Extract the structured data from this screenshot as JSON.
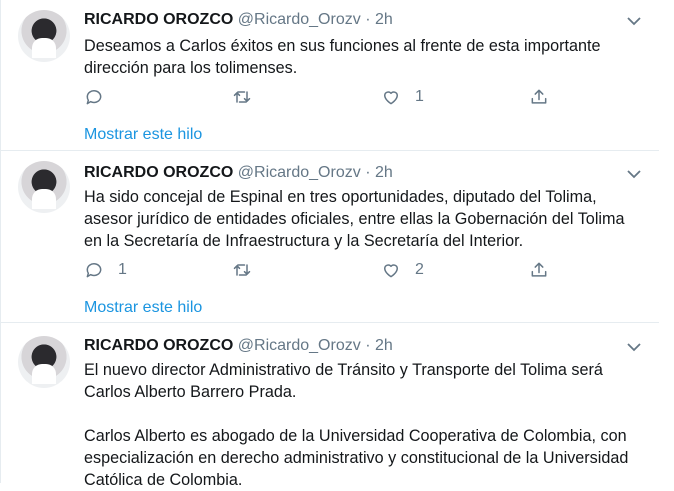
{
  "tweets": [
    {
      "name": "RICARDO OROZCO",
      "handle": "@Ricardo_Orozv",
      "dot": "·",
      "time": "2h",
      "text": "Deseamos a Carlos éxitos en sus funciones al frente de esta importante\ndirección para los tolimenses.",
      "replies": "",
      "retweets": "",
      "likes": "1",
      "thread_link": "Mostrar este hilo"
    },
    {
      "name": "RICARDO OROZCO",
      "handle": "@Ricardo_Orozv",
      "dot": "·",
      "time": "2h",
      "text": "Ha sido concejal de Espinal en tres oportunidades, diputado del Tolima,\nasesor jurídico de entidades oficiales, entre ellas la Gobernación del Tolima\nen la Secretaría de Infraestructura y la Secretaría del Interior.",
      "replies": "1",
      "retweets": "",
      "likes": "2",
      "thread_link": "Mostrar este hilo"
    },
    {
      "name": "RICARDO OROZCO",
      "handle": "@Ricardo_Orozv",
      "dot": "·",
      "time": "2h",
      "text": "El nuevo director Administrativo de Tránsito y Transporte del Tolima será\nCarlos Alberto Barrero Prada.\n\nCarlos Alberto es abogado de la Universidad Cooperativa de Colombia, con\nespecialización en derecho administrativo y constitucional de la Universidad\nCatólica de Colombia."
    }
  ]
}
